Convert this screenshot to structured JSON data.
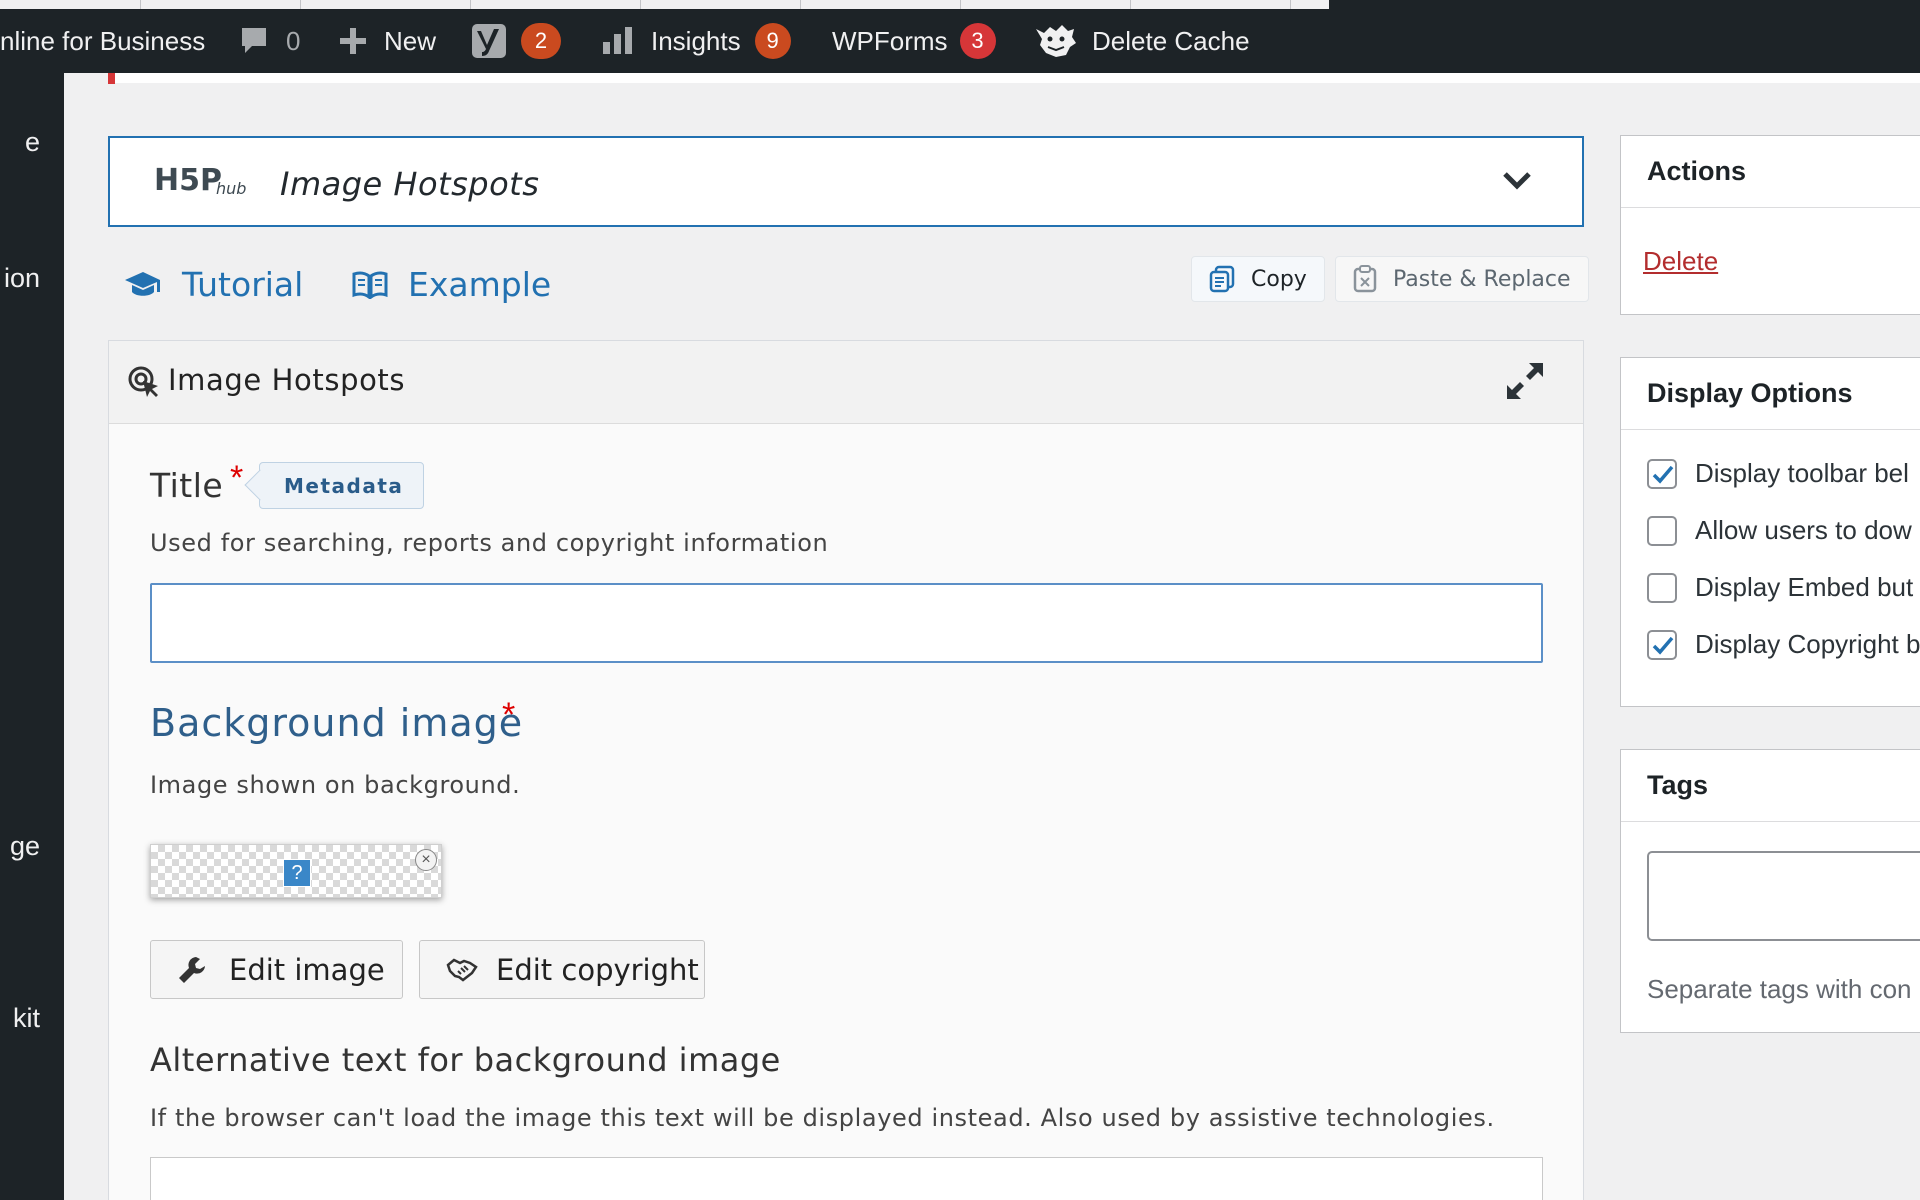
{
  "admin_bar": {
    "site_name": "nline for Business",
    "comments_count": "0",
    "new_label": "New",
    "yoast_count": "2",
    "insights_label": "Insights",
    "insights_count": "9",
    "wpforms_label": "WPForms",
    "wpforms_count": "3",
    "delete_cache_label": "Delete Cache"
  },
  "sidebar": {
    "fragments": [
      "e",
      "ion",
      "ge",
      "kit"
    ]
  },
  "hub": {
    "logo_text": "H5P",
    "logo_sub": "hub",
    "selected_content_type": "Image Hotspots"
  },
  "links": {
    "tutorial": "Tutorial",
    "example": "Example"
  },
  "clipboard": {
    "copy": "Copy",
    "paste_replace": "Paste & Replace"
  },
  "editor": {
    "header": "Image Hotspots",
    "title_field": {
      "label": "Title",
      "required_mark": "*",
      "metadata_button": "Metadata",
      "description": "Used for searching, reports and copyright information",
      "value": ""
    },
    "background_image": {
      "label": "Background image",
      "required_mark": "*",
      "description": "Image shown on background.",
      "placeholder_glyph": "?",
      "remove_glyph": "×",
      "edit_image": "Edit image",
      "edit_copyright": "Edit copyright"
    },
    "alt_text": {
      "label": "Alternative text for background image",
      "description": "If the browser can't load the image this text will be displayed instead. Also used by assistive technologies.",
      "value": ""
    }
  },
  "actions_box": {
    "title": "Actions",
    "delete": "Delete"
  },
  "display_options": {
    "title": "Display Options",
    "options": [
      {
        "label": "Display toolbar bel",
        "checked": true
      },
      {
        "label": "Allow users to dow",
        "checked": false
      },
      {
        "label": "Display Embed but",
        "checked": false
      },
      {
        "label": "Display Copyright b",
        "checked": true
      }
    ]
  },
  "tags_box": {
    "title": "Tags",
    "value": "",
    "hint": "Separate tags with con"
  },
  "colors": {
    "admin_bar": "#1d2327",
    "link_blue": "#2271b1",
    "section_blue": "#2f5f8b",
    "badge_red": "#d63638",
    "delete_red": "#b32d2e"
  }
}
